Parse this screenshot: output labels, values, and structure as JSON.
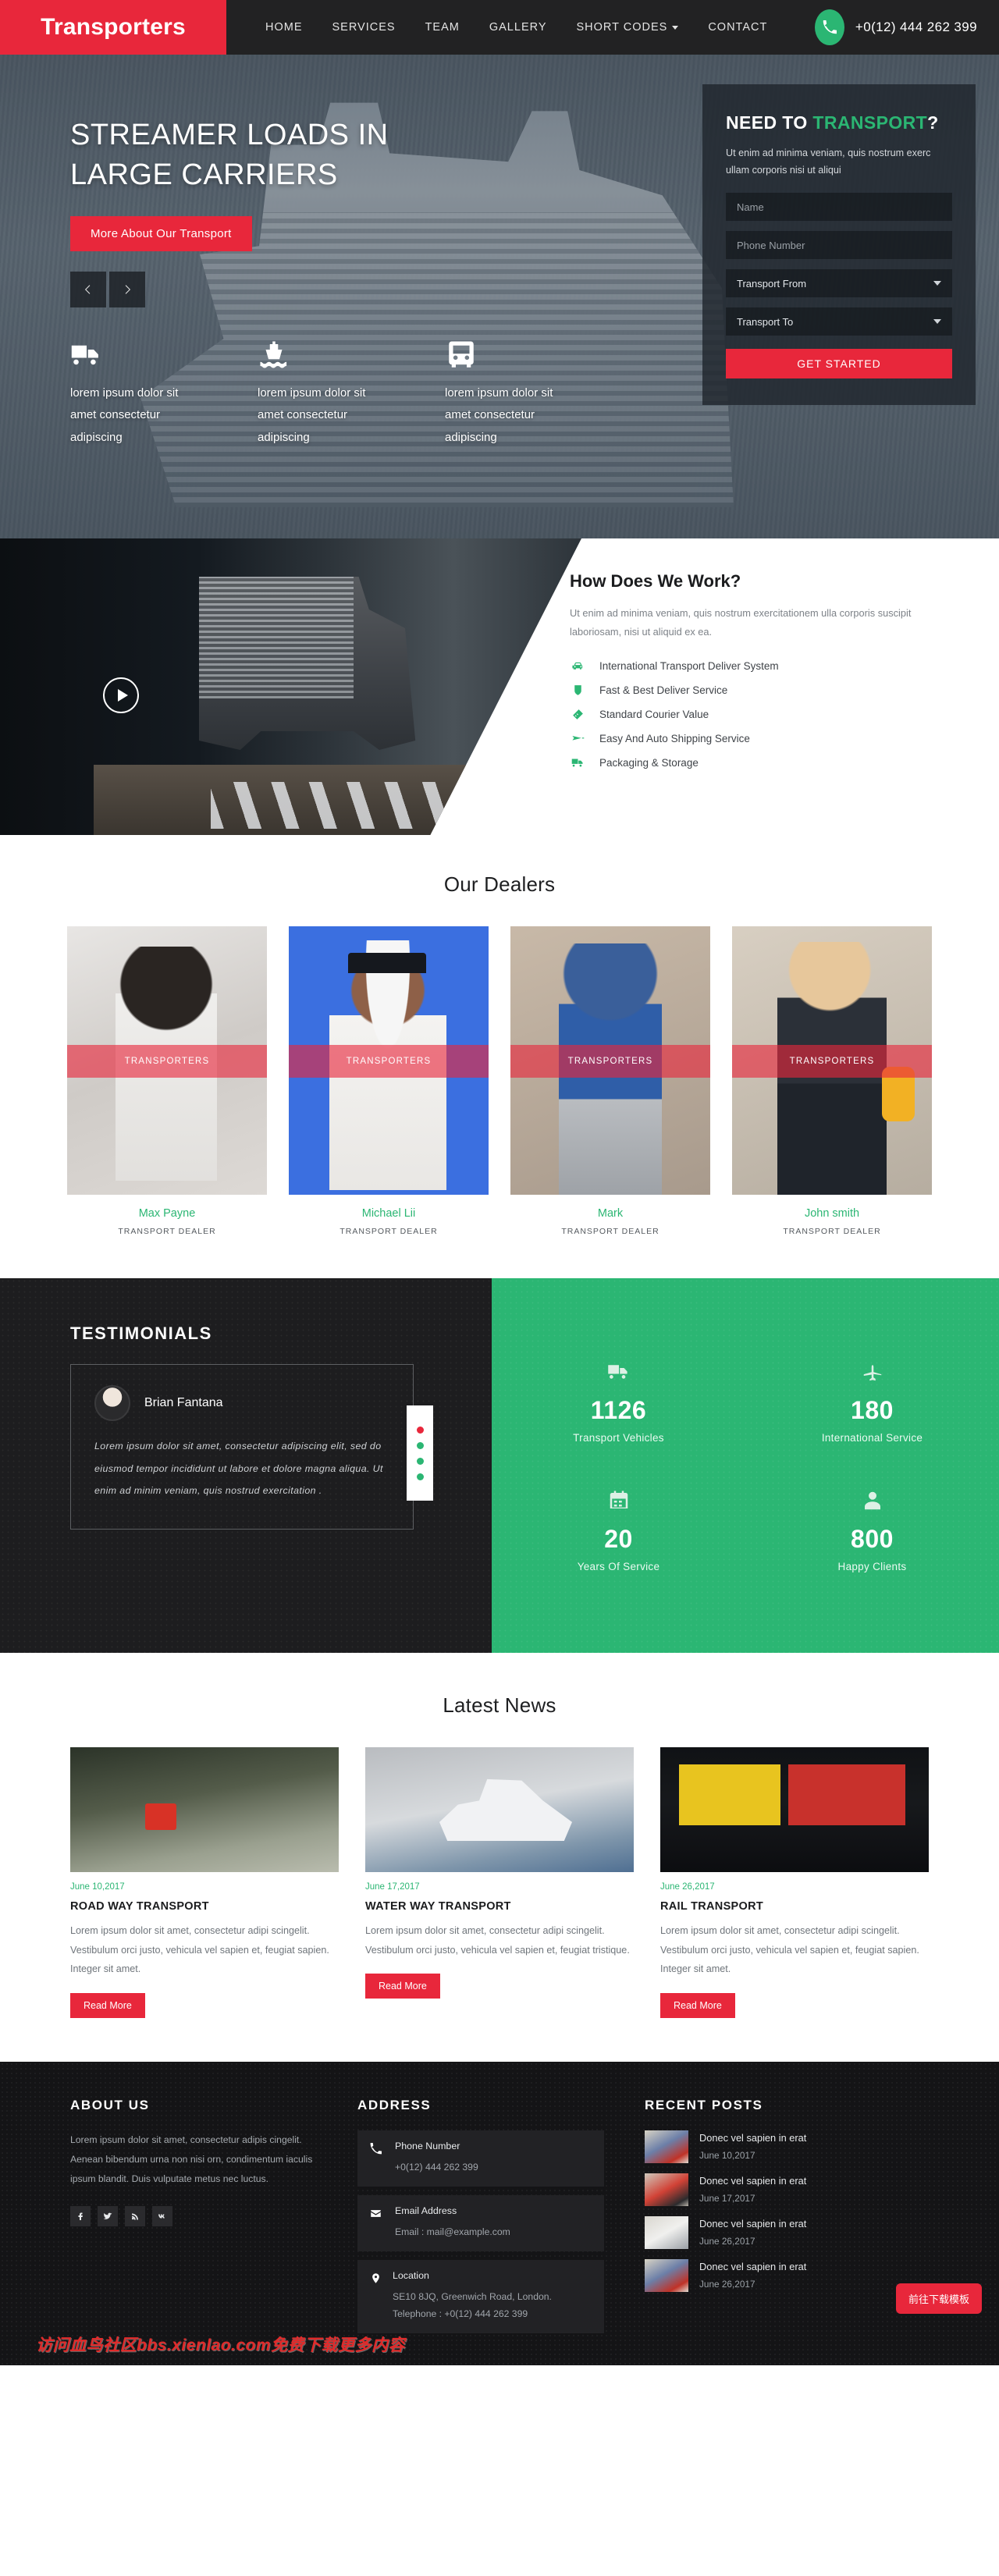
{
  "header": {
    "logo": "Transporters",
    "nav": [
      {
        "label": "HOME",
        "caret": false
      },
      {
        "label": "SERVICES",
        "caret": false
      },
      {
        "label": "TEAM",
        "caret": false
      },
      {
        "label": "GALLERY",
        "caret": false
      },
      {
        "label": "SHORT CODES",
        "caret": true
      },
      {
        "label": "CONTACT",
        "caret": false
      }
    ],
    "phone": "+0(12) 444 262 399"
  },
  "hero": {
    "title_line1": "STREAMER LOADS IN",
    "title_line2": "LARGE CARRIERS",
    "button": "More About Our Transport",
    "features": [
      {
        "icon": "truck-icon",
        "text": "lorem ipsum dolor sit amet consectetur adipiscing"
      },
      {
        "icon": "ship-icon",
        "text": "lorem ipsum dolor sit amet consectetur adipiscing"
      },
      {
        "icon": "bus-icon",
        "text": "lorem ipsum dolor sit amet consectetur adipiscing"
      }
    ],
    "quote": {
      "title_prefix": "NEED TO ",
      "title_accent": "TRANSPORT",
      "title_suffix": "?",
      "subtitle": "Ut enim ad minima veniam, quis nostrum exerc ullam corporis nisi ut aliqui",
      "name_placeholder": "Name",
      "name_value": "",
      "phone_placeholder": "Phone Number",
      "phone_value": "",
      "from_label": "Transport From",
      "to_label": "Transport To",
      "submit": "GET STARTED"
    }
  },
  "work": {
    "title": "How Does We Work?",
    "lead": "Ut enim ad minima veniam, quis nostrum exercitationem ulla corporis suscipit laboriosam, nisi ut aliquid ex ea.",
    "items": [
      {
        "icon": "car-icon",
        "label": "International Transport Deliver System"
      },
      {
        "icon": "shield-icon",
        "label": "Fast & Best Deliver Service"
      },
      {
        "icon": "tag-icon",
        "label": "Standard Courier Value"
      },
      {
        "icon": "paper-plane-icon",
        "label": "Easy And Auto Shipping Service"
      },
      {
        "icon": "truck-icon",
        "label": "Packaging & Storage"
      }
    ]
  },
  "dealers": {
    "title": "Our Dealers",
    "band_label": "TRANSPORTERS",
    "items": [
      {
        "name": "Max Payne",
        "role": "TRANSPORT DEALER"
      },
      {
        "name": "Michael Lii",
        "role": "TRANSPORT DEALER"
      },
      {
        "name": "Mark",
        "role": "TRANSPORT DEALER"
      },
      {
        "name": "John smith",
        "role": "TRANSPORT DEALER"
      }
    ]
  },
  "testimonials": {
    "title": "TESTIMONIALS",
    "author": "Brian Fantana",
    "quote": "Lorem ipsum dolor sit amet, consectetur adipiscing elit, sed do eiusmod tempor incididunt ut labore et dolore magna aliqua. Ut enim ad minim veniam, quis nostrud exercitation .",
    "dots": [
      "active",
      "",
      "",
      ""
    ]
  },
  "stats": [
    {
      "icon": "truck-icon",
      "number": "1126",
      "label": "Transport Vehicles"
    },
    {
      "icon": "plane-icon",
      "number": "180",
      "label": "International Service"
    },
    {
      "icon": "calendar-icon",
      "number": "20",
      "label": "Years Of Service"
    },
    {
      "icon": "user-icon",
      "number": "800",
      "label": "Happy Clients"
    }
  ],
  "news": {
    "title": "Latest News",
    "items": [
      {
        "date": "June 10,2017",
        "title": "ROAD WAY TRANSPORT",
        "text": "Lorem ipsum dolor sit amet, consectetur adipi scingelit. Vestibulum orci justo, vehicula vel sapien et, feugiat sapien. Integer sit amet.",
        "button": "Read More"
      },
      {
        "date": "June 17,2017",
        "title": "WATER WAY TRANSPORT",
        "text": "Lorem ipsum dolor sit amet, consectetur adipi scingelit. Vestibulum orci justo, vehicula vel sapien et, feugiat tristique.",
        "button": "Read More"
      },
      {
        "date": "June 26,2017",
        "title": "RAIL TRANSPORT",
        "text": "Lorem ipsum dolor sit amet, consectetur adipi scingelit. Vestibulum orci justo, vehicula vel sapien et, feugiat sapien. Integer sit amet.",
        "button": "Read More"
      }
    ]
  },
  "footer": {
    "about": {
      "heading": "ABOUT US",
      "text": "Lorem ipsum dolor sit amet, consectetur adipis cingelit. Aenean bibendum urna non nisi orn, condimentum iaculis ipsum blandit. Duis vulputate metus nec luctus.",
      "social": [
        "facebook-icon",
        "twitter-icon",
        "rss-icon",
        "vk-icon"
      ]
    },
    "address": {
      "heading": "ADDRESS",
      "blocks": [
        {
          "icon": "phone-icon",
          "title": "Phone Number",
          "value": "+0(12) 444 262 399"
        },
        {
          "icon": "envelope-icon",
          "title": "Email Address",
          "value": "Email : mail@example.com"
        },
        {
          "icon": "map-pin-icon",
          "title": "Location",
          "value": "SE10 8JQ, Greenwich Road, London. Telephone : +0(12) 444 262 399"
        }
      ]
    },
    "posts": {
      "heading": "RECENT POSTS",
      "items": [
        {
          "title": "Donec vel sapien in erat",
          "date": "June 10,2017"
        },
        {
          "title": "Donec vel sapien in erat",
          "date": "June 17,2017"
        },
        {
          "title": "Donec vel sapien in erat",
          "date": "June 26,2017"
        },
        {
          "title": "Donec vel sapien in erat",
          "date": "June 26,2017"
        }
      ]
    }
  },
  "overlay": {
    "watermark": "访问血鸟社区bbs.xienlao.com免费下载更多内容",
    "download_button": "前往下载模板"
  },
  "colors": {
    "brand_red": "#e8273b",
    "brand_green": "#2bb673",
    "dark": "#1d1d1f"
  }
}
